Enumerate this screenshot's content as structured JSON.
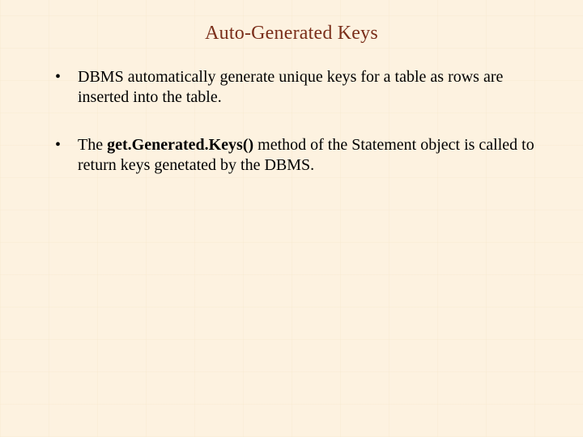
{
  "title": "Auto-Generated Keys",
  "bullets": [
    {
      "pre": "DBMS automatically  generate unique keys for a table as rows are inserted  into the table."
    },
    {
      "pre": "The ",
      "bold": "get.Generated.Keys()",
      "post": " method of the Statement object is called to return keys genetated by the DBMS."
    }
  ]
}
